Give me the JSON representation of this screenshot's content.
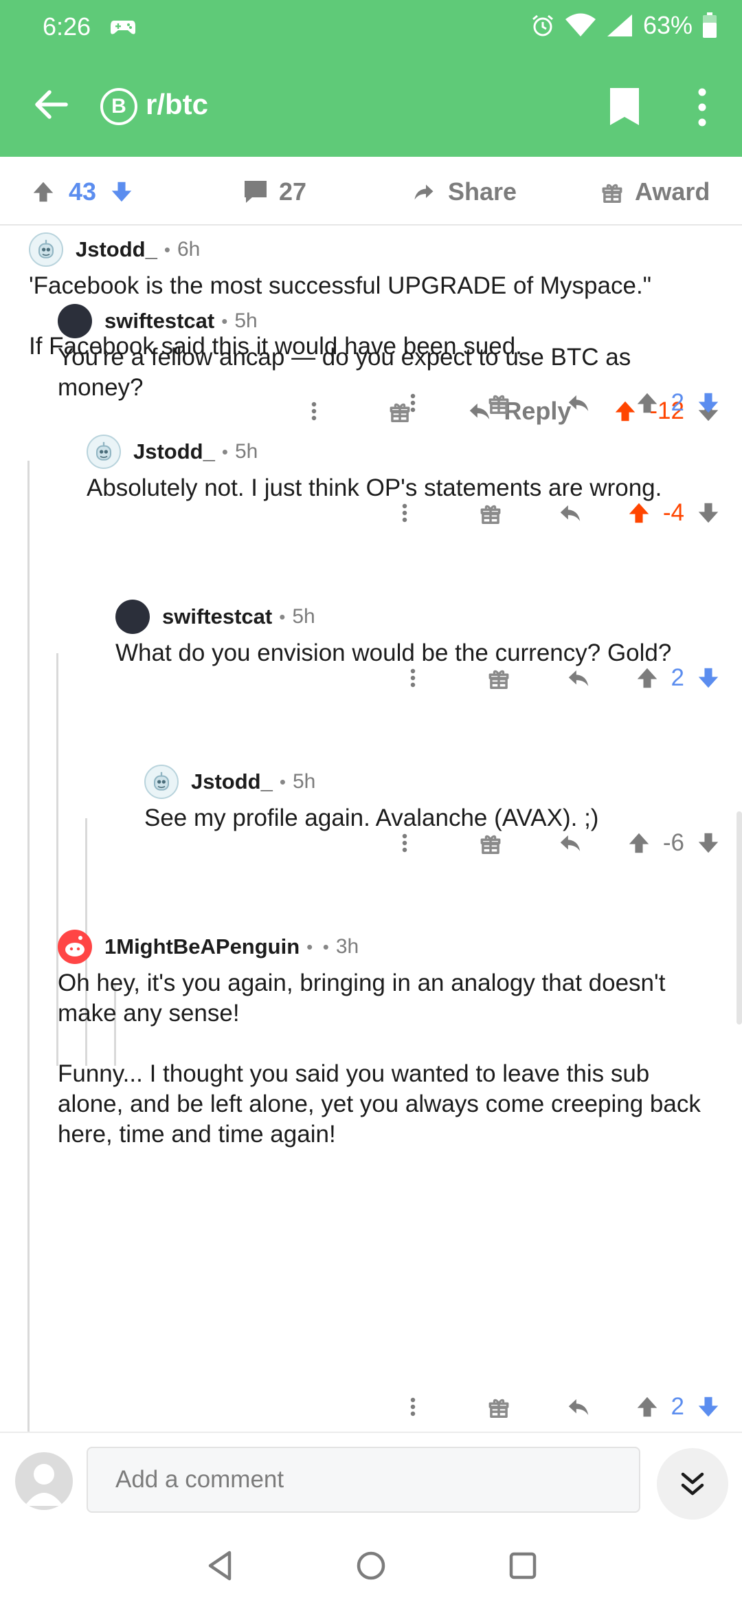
{
  "status_bar": {
    "time": "6:26",
    "battery": "63%"
  },
  "header": {
    "subreddit_badge": "B",
    "subreddit": "r/btc"
  },
  "post_actions": {
    "score": "43",
    "comments": "27",
    "share_label": "Share",
    "award_label": "Award"
  },
  "comments": [
    {
      "author": "Jstodd_",
      "time": "6h",
      "body": "'Facebook is the most successful UPGRADE of Myspace.\"\n\nIf Facebook said this it would have been sued.",
      "reply_label": "Reply",
      "score": "-12",
      "vote": "up"
    },
    {
      "author": "swiftestcat",
      "time": "5h",
      "body": "You're a fellow ancap — do you expect to use BTC as money?",
      "score": "2",
      "vote": "down"
    },
    {
      "author": "Jstodd_",
      "time": "5h",
      "body": "Absolutely not. I just think OP's statements are wrong.",
      "score": "-4",
      "vote": "up"
    },
    {
      "author": "swiftestcat",
      "time": "5h",
      "body": "What do you envision would be the currency? Gold?",
      "score": "2",
      "vote": "down"
    },
    {
      "author": "Jstodd_",
      "time": "5h",
      "body": "See my profile again. Avalanche (AVAX). ;)",
      "score": "-6",
      "vote": "none"
    },
    {
      "author": "1MightBeAPenguin",
      "time": "3h",
      "body": "Oh hey, it's you again, bringing in an analogy that doesn't make any sense!\n\nFunny... I thought you said you wanted to leave this sub alone, and be left alone, yet you always come creeping back here, time and time again!",
      "score": "2",
      "vote": "down"
    }
  ],
  "composer": {
    "placeholder": "Add a comment"
  },
  "colors": {
    "header_green": "#5fca78",
    "upvote_orange": "#ff4500",
    "downvote_blue": "#5b8def",
    "meta_grey": "#7c7c7c"
  },
  "icons": [
    "back-arrow-icon",
    "bitcoin-icon",
    "bookmark-icon",
    "more-vertical-icon",
    "upvote-icon",
    "downvote-icon",
    "comment-icon",
    "share-icon",
    "gift-icon",
    "reply-icon",
    "chevron-double-down-icon",
    "nav-back-icon",
    "nav-home-icon",
    "nav-recents-icon"
  ]
}
